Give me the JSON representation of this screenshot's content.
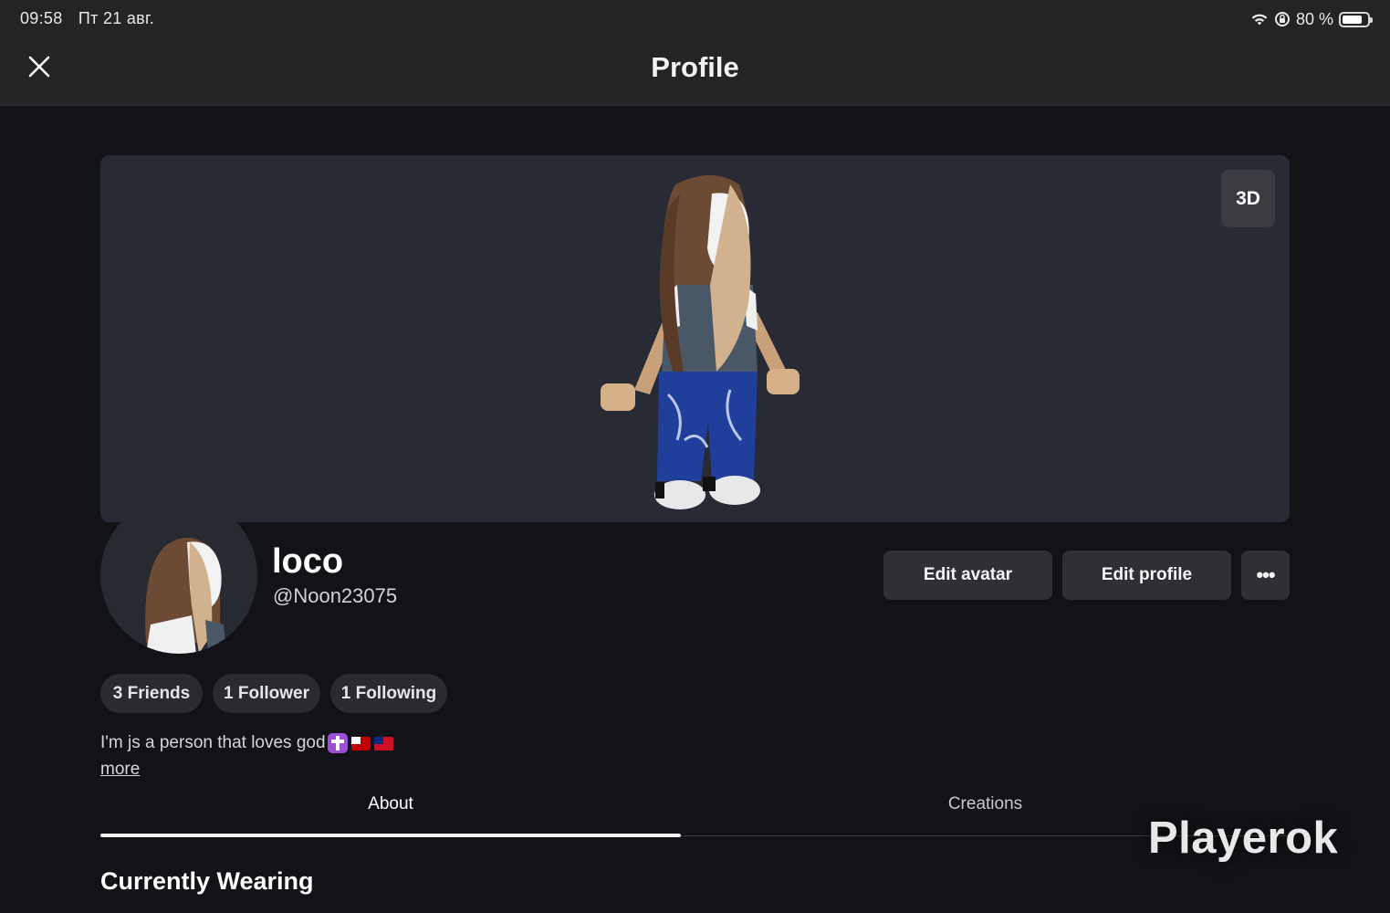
{
  "status_bar": {
    "time": "09:58",
    "date": "Пт 21 авг.",
    "battery_text": "80 %",
    "battery_level": 0.8,
    "icons": [
      "wifi-icon",
      "orientation-lock-icon",
      "battery-icon"
    ]
  },
  "nav": {
    "title": "Profile",
    "close_icon": "close-icon"
  },
  "hero": {
    "view_toggle_label": "3D"
  },
  "profile": {
    "display_name": "loco",
    "username": "@Noon23075"
  },
  "actions": {
    "edit_avatar": "Edit avatar",
    "edit_profile": "Edit profile",
    "more": "•••"
  },
  "stats": {
    "friends": "3 Friends",
    "followers": "1 Follower",
    "following": "1 Following"
  },
  "bio": {
    "text": "I'm js a person that loves god",
    "emojis": [
      "latin-cross-emoji",
      "tonga-flag-emoji",
      "samoa-flag-emoji"
    ],
    "more_link": "more"
  },
  "tabs": [
    {
      "label": "About",
      "active": true
    },
    {
      "label": "Creations",
      "active": false
    }
  ],
  "section": {
    "title": "Currently Wearing"
  },
  "watermark": "Playerok",
  "colors": {
    "background": "#121317",
    "top_bar": "#232426",
    "hero_panel": "#282b34",
    "button": "#2f3036"
  }
}
